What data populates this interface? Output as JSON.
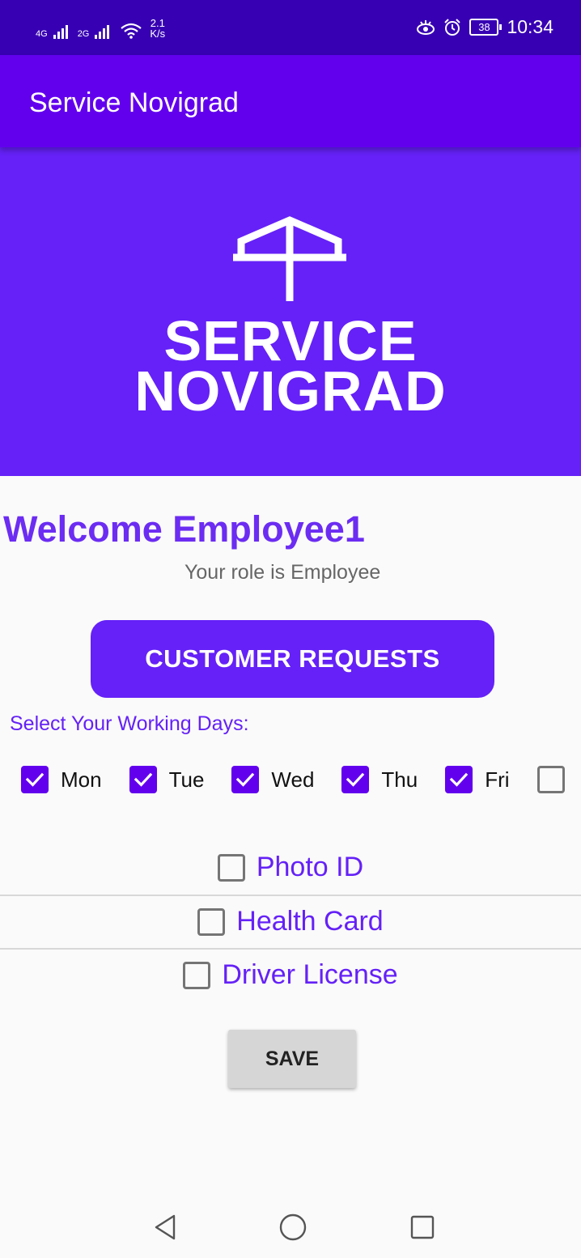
{
  "status_bar": {
    "network1": "4G",
    "network2": "2G",
    "speed_value": "2.1",
    "speed_unit": "K/s",
    "battery": "38",
    "time": "10:34"
  },
  "app_bar": {
    "title": "Service Novigrad"
  },
  "banner": {
    "logo_line1": "SERVICE",
    "logo_line2": "NOVIGRAD"
  },
  "welcome": {
    "title": "Welcome Employee1",
    "role": "Your role is Employee"
  },
  "customer_requests_button": "CUSTOMER REQUESTS",
  "working_days": {
    "label": "Select Your Working Days:",
    "days": [
      {
        "label": "Mon",
        "checked": true
      },
      {
        "label": "Tue",
        "checked": true
      },
      {
        "label": "Wed",
        "checked": true
      },
      {
        "label": "Thu",
        "checked": true
      },
      {
        "label": "Fri",
        "checked": true
      },
      {
        "label": "",
        "checked": false
      }
    ]
  },
  "documents": [
    {
      "label": "Photo ID",
      "checked": false
    },
    {
      "label": "Health Card",
      "checked": false
    },
    {
      "label": "Driver License",
      "checked": false
    }
  ],
  "save_button": "SAVE",
  "colors": {
    "primary": "#6200ee",
    "primary_dark": "#3700b3",
    "accent": "#6521f7"
  }
}
